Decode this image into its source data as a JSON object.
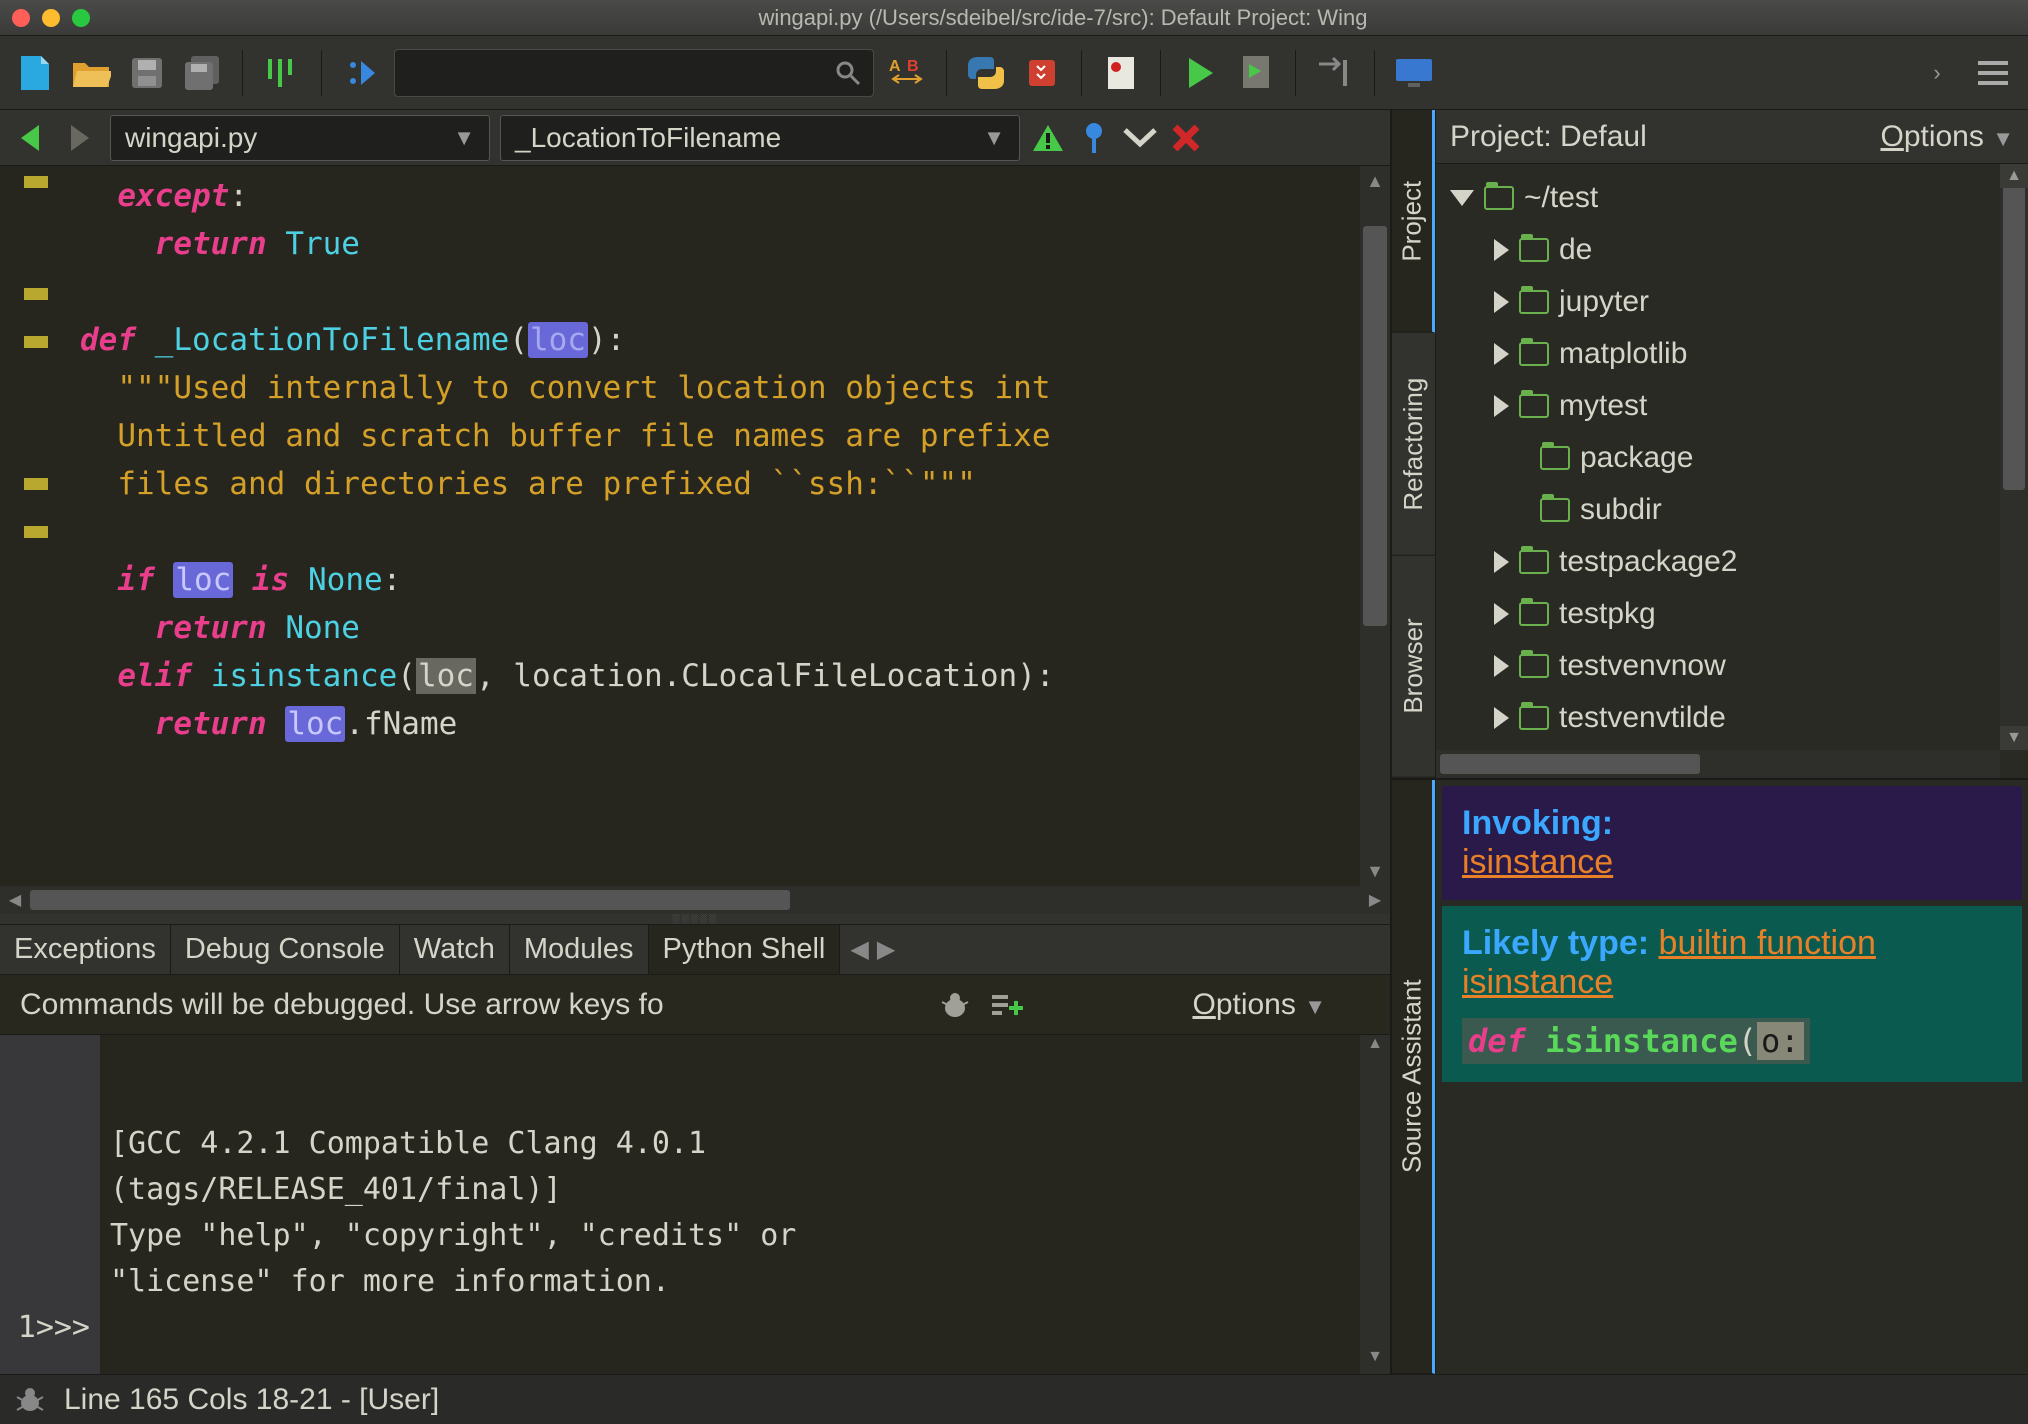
{
  "titlebar": {
    "title": "wingapi.py (/Users/sdeibel/src/ide-7/src): Default Project: Wing"
  },
  "editor_header": {
    "file_selector": "wingapi.py",
    "symbol_selector": "_LocationToFilename"
  },
  "code": {
    "l1_kw": "except",
    "l1_colon": ":",
    "l2_kw": "return",
    "l2_val": "True",
    "l3_kw": "def",
    "l3_fn": "_LocationToFilename",
    "l3_open": "(",
    "l3_param": "loc",
    "l3_close": "):",
    "l4": "\"\"\"Used internally to convert location objects int",
    "l5": "Untitled and scratch buffer file names are prefixe",
    "l6": "files and directories are prefixed ``ssh:``\"\"\"",
    "l7_kw": "if",
    "l7_var": "loc",
    "l7_is": "is",
    "l7_none": "None",
    "l7_colon": ":",
    "l8_kw": "return",
    "l8_none": "None",
    "l9_kw": "elif",
    "l9_fn": "isinstance",
    "l9_open": "(",
    "l9_sel": "loc",
    "l9_rest": ", location.CLocalFileLocation):",
    "l10_kw": "return",
    "l10_var": "loc",
    "l10_rest": ".fName"
  },
  "bottom_tabs": {
    "t1": "Exceptions",
    "t2": "Debug Console",
    "t3": "Watch",
    "t4": "Modules",
    "t5": "Python Shell"
  },
  "shell_sub": {
    "msg": "Commands will be debugged.  Use arrow keys fo",
    "options_u": "O",
    "options_rest": "ptions"
  },
  "shell_body": {
    "l1": "[GCC 4.2.1 Compatible Clang 4.0.1",
    "l2": "(tags/RELEASE_401/final)]",
    "l3": "Type \"help\", \"copyright\", \"credits\" or",
    "l4": "\"license\" for more information.",
    "prompt_n": "1",
    "prompt": ">>>"
  },
  "right_vtabs": {
    "t1": "Project",
    "t2": "Refactoring",
    "t3": "Browser"
  },
  "project_header": {
    "title": "Project: Defaul",
    "options_u": "O",
    "options_rest": "ptions"
  },
  "tree": {
    "root": "~/test",
    "items": [
      "de",
      "jupyter",
      "matplotlib",
      "mytest",
      "package",
      "subdir",
      "testpackage2",
      "testpkg",
      "testvenvnow",
      "testvenvtilde"
    ]
  },
  "right_vtabs_bottom": {
    "t1": "Source Assistant"
  },
  "source_assistant": {
    "invoking_label": "Invoking:",
    "invoking_link": "isinstance",
    "likely_label": "Likely type:",
    "likely_link": "builtin function isinstance",
    "sig_def": "def",
    "sig_fn": "isinstance",
    "sig_open": "(",
    "sig_p1": "o:"
  },
  "status": {
    "text": "Line 165 Cols 18-21 - [User]"
  }
}
